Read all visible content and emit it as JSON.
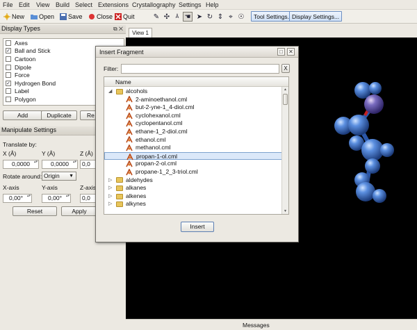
{
  "menu": [
    "File",
    "Edit",
    "View",
    "Build",
    "Select",
    "Extensions",
    "Crystallography",
    "Settings",
    "Help"
  ],
  "toolbar": {
    "new_label": "New",
    "open_label": "Open",
    "save_label": "Save",
    "close_label": "Close",
    "quit_label": "Quit",
    "tool_settings_label": "Tool Settings...",
    "display_settings_label": "Display Settings..."
  },
  "display_types": {
    "title": "Display Types",
    "items": [
      {
        "label": "Axes",
        "checked": false
      },
      {
        "label": "Ball and Stick",
        "checked": true
      },
      {
        "label": "Cartoon",
        "checked": false
      },
      {
        "label": "Dipole",
        "checked": false
      },
      {
        "label": "Force",
        "checked": false
      },
      {
        "label": "Hydrogen Bond",
        "checked": true
      },
      {
        "label": "Label",
        "checked": false
      },
      {
        "label": "Polygon",
        "checked": false
      }
    ],
    "add_label": "Add",
    "duplicate_label": "Duplicate",
    "remove_label": "Re"
  },
  "manipulate": {
    "title": "Manipulate Settings",
    "translate_label": "Translate by:",
    "x_label": "X (Å)",
    "y_label": "Y (Å)",
    "z_label": "Z (Å)",
    "x_value": "0,0000",
    "y_value": "0,0000",
    "z_value": "0,0",
    "rotate_label": "Rotate around:",
    "rotate_value": "Origin",
    "xaxis_label": "X-axis",
    "yaxis_label": "Y-axis",
    "zaxis_label": "Z-axis",
    "xaxis_value": "0,00°",
    "yaxis_value": "0,00°",
    "zaxis_value": "0,0",
    "reset_label": "Reset",
    "apply_label": "Apply"
  },
  "view_tab": "View 1",
  "messages_label": "Messages",
  "dialog": {
    "title": "Insert Fragment",
    "filter_label": "Filter:",
    "filter_value": "",
    "clear_label": "X",
    "column_name": "Name",
    "folder_open": "alcohols",
    "files": [
      "2-aminoethanol.cml",
      "but-2-yne-1_4-diol.cml",
      "cyclohexanol.cml",
      "cyclopentanol.cml",
      "ethane-1_2-diol.cml",
      "ethanol.cml",
      "methanol.cml",
      "propan-1-ol.cml",
      "propan-2-ol.cml",
      "propane-1_2_3-triol.cml"
    ],
    "selected_file": "propan-1-ol.cml",
    "folders_closed": [
      "aldehydes",
      "alkanes",
      "alkenes",
      "alkynes"
    ],
    "insert_label": "Insert"
  },
  "colors": {
    "selection": "#dbe8f9",
    "viewport_bg": "#000000",
    "atom": "#3f74c9"
  }
}
